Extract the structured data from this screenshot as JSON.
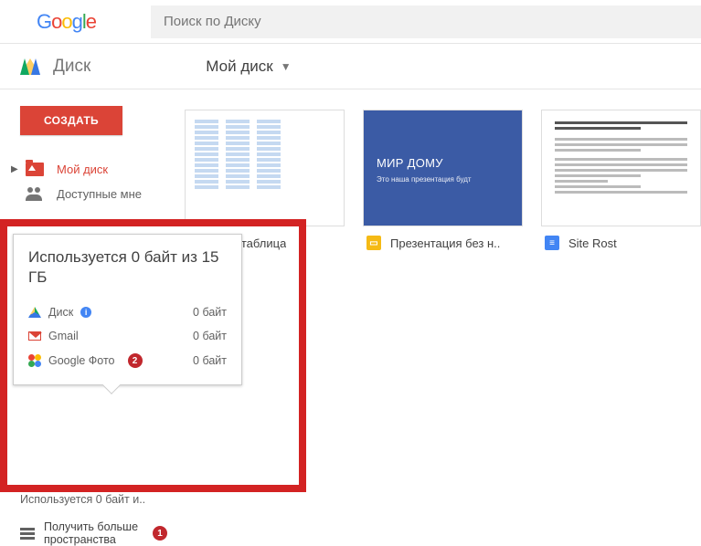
{
  "header": {
    "search_placeholder": "Поиск по Диску"
  },
  "app": {
    "title": "Диск",
    "breadcrumb": "Мой диск"
  },
  "toolbar": {
    "create_label": "СОЗДАТЬ"
  },
  "sidebar": {
    "items": [
      {
        "label": "Мой диск",
        "active": true
      },
      {
        "label": "Доступные мне",
        "active": false
      }
    ],
    "used_summary": "Используется 0 байт и..",
    "get_more_line1": "Получить больше",
    "get_more_line2": "пространства"
  },
  "files": [
    {
      "name": "овая таблица",
      "type": "sheet"
    },
    {
      "name": "Презентация без н..",
      "type": "slide",
      "slide_title": "МИР ДОМУ",
      "slide_sub": "Это наша презентация будт"
    },
    {
      "name": "Site Rost",
      "type": "doc"
    }
  ],
  "storage_popup": {
    "title": "Используется 0 байт из 15 ГБ",
    "rows": [
      {
        "label": "Диск",
        "value": "0 байт",
        "info": true
      },
      {
        "label": "Gmail",
        "value": "0 байт"
      },
      {
        "label": "Google Фото",
        "value": "0 байт"
      }
    ]
  },
  "annotations": {
    "badge1": "1",
    "badge2": "2"
  }
}
